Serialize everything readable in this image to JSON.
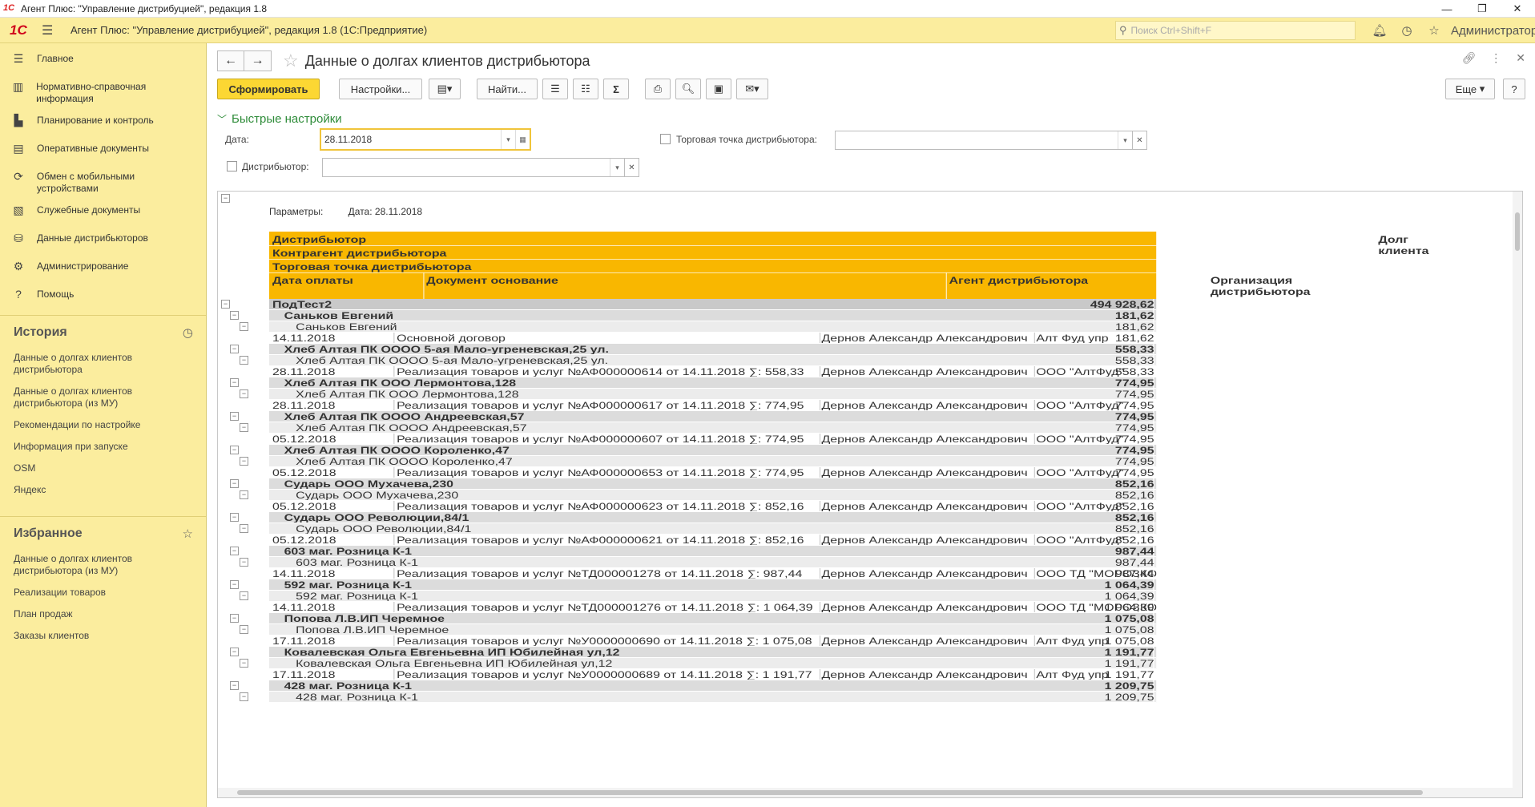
{
  "window": {
    "title": "Агент Плюс: \"Управление дистрибуцией\", редакция 1.8"
  },
  "appbar": {
    "title": "Агент Плюс: \"Управление дистрибуцией\", редакция 1.8  (1С:Предприятие)",
    "search_placeholder": "Поиск Ctrl+Shift+F",
    "user": "Администратор"
  },
  "sidebar": {
    "items": [
      {
        "label": "Главное",
        "icon": "menu-icon"
      },
      {
        "label": "Нормативно-справочная информация",
        "icon": "catalog-icon"
      },
      {
        "label": "Планирование и контроль",
        "icon": "chart-icon"
      },
      {
        "label": "Оперативные документы",
        "icon": "documents-icon"
      },
      {
        "label": "Обмен с мобильными устройствами",
        "icon": "sync-icon"
      },
      {
        "label": "Служебные документы",
        "icon": "service-docs-icon"
      },
      {
        "label": "Данные дистрибьюторов",
        "icon": "distributors-icon"
      },
      {
        "label": "Администрирование",
        "icon": "gear-icon"
      },
      {
        "label": "Помощь",
        "icon": "help-icon"
      }
    ],
    "history": {
      "title": "История",
      "items": [
        "Данные о долгах клиентов дистрибьютора",
        "Данные о долгах клиентов дистрибьютора (из МУ)",
        "Рекомендации по настройке",
        "Информация при запуске",
        "OSM",
        "Яндекс"
      ]
    },
    "favorites": {
      "title": "Избранное",
      "items": [
        "Данные о долгах клиентов дистрибьютора (из МУ)",
        "Реализации товаров",
        "План продаж",
        "Заказы клиентов"
      ]
    }
  },
  "page": {
    "title": "Данные о долгах клиентов дистрибьютора",
    "toolbar": {
      "generate": "Сформировать",
      "settings": "Настройки...",
      "find": "Найти...",
      "more": "Еще",
      "help": "?"
    },
    "quick_settings": {
      "title": "Быстрые настройки",
      "date_label": "Дата:",
      "date_value": "28.11.2018",
      "outlet_label": "Торговая точка дистрибьютора:",
      "distributor_label": "Дистрибьютор:"
    }
  },
  "report": {
    "params_label": "Параметры:",
    "params_value": "Дата: 28.11.2018",
    "headers": {
      "h1": "Дистрибьютор",
      "h2": "Контрагент дистрибьютора",
      "h3": "Торговая точка дистрибьютора",
      "date": "Дата оплаты",
      "doc": "Документ основание",
      "agent": "Агент дистрибьютора",
      "org": "Организация дистрибьютора",
      "debt": "Долг клиента"
    },
    "rows": [
      {
        "lvl": 0,
        "name": "ПодТест2",
        "sum": "494 928,62"
      },
      {
        "lvl": 1,
        "name": "Саньков Евгений",
        "sum": "181,62"
      },
      {
        "lvl": 2,
        "name": "Саньков Евгений",
        "sum": "181,62"
      },
      {
        "lvl": 3,
        "date": "14.11.2018",
        "doc": "Основной договор",
        "agent": "Дернов Александр Александрович",
        "org": "Алт Фуд упр",
        "sum": "181,62"
      },
      {
        "lvl": 1,
        "name": "Хлеб Алтая ПК ОООО 5-ая Мало-угреневская,25 ул.",
        "sum": "558,33"
      },
      {
        "lvl": 2,
        "name": "Хлеб Алтая ПК ОООО 5-ая Мало-угреневская,25 ул.",
        "sum": "558,33"
      },
      {
        "lvl": 3,
        "date": "28.11.2018",
        "doc": "Реализация товаров и услуг №АФ000000614 от 14.11.2018 ∑: 558,33",
        "agent": "Дернов Александр Александрович",
        "org": "ООО \"АлтФуд\"",
        "sum": "558,33"
      },
      {
        "lvl": 1,
        "name": "Хлеб Алтая ПК ООО Лермонтова,128",
        "sum": "774,95"
      },
      {
        "lvl": 2,
        "name": "Хлеб Алтая ПК ООО Лермонтова,128",
        "sum": "774,95"
      },
      {
        "lvl": 3,
        "date": "28.11.2018",
        "doc": "Реализация товаров и услуг №АФ000000617 от 14.11.2018 ∑: 774,95",
        "agent": "Дернов Александр Александрович",
        "org": "ООО \"АлтФуд\"",
        "sum": "774,95"
      },
      {
        "lvl": 1,
        "name": "Хлеб Алтая ПК ОООО Андреевская,57",
        "sum": "774,95"
      },
      {
        "lvl": 2,
        "name": "Хлеб Алтая ПК ОООО Андреевская,57",
        "sum": "774,95"
      },
      {
        "lvl": 3,
        "date": "05.12.2018",
        "doc": "Реализация товаров и услуг №АФ000000607 от 14.11.2018 ∑: 774,95",
        "agent": "Дернов Александр Александрович",
        "org": "ООО \"АлтФуд\"",
        "sum": "774,95"
      },
      {
        "lvl": 1,
        "name": "Хлеб Алтая ПК ОООО Короленко,47",
        "sum": "774,95"
      },
      {
        "lvl": 2,
        "name": "Хлеб Алтая ПК ОООО Короленко,47",
        "sum": "774,95"
      },
      {
        "lvl": 3,
        "date": "05.12.2018",
        "doc": "Реализация товаров и услуг №АФ000000653 от 14.11.2018 ∑: 774,95",
        "agent": "Дернов Александр Александрович",
        "org": "ООО \"АлтФуд\"",
        "sum": "774,95"
      },
      {
        "lvl": 1,
        "name": "Сударь ООО Мухачева,230",
        "sum": "852,16"
      },
      {
        "lvl": 2,
        "name": "Сударь ООО Мухачева,230",
        "sum": "852,16"
      },
      {
        "lvl": 3,
        "date": "05.12.2018",
        "doc": "Реализация товаров и услуг №АФ000000623 от 14.11.2018 ∑: 852,16",
        "agent": "Дернов Александр Александрович",
        "org": "ООО \"АлтФуд\"",
        "sum": "852,16"
      },
      {
        "lvl": 1,
        "name": "Сударь ООО Революции,84/1",
        "sum": "852,16"
      },
      {
        "lvl": 2,
        "name": "Сударь ООО Революции,84/1",
        "sum": "852,16"
      },
      {
        "lvl": 3,
        "date": "05.12.2018",
        "doc": "Реализация товаров и услуг №АФ000000621 от 14.11.2018 ∑: 852,16",
        "agent": "Дернов Александр Александрович",
        "org": "ООО \"АлтФуд\"",
        "sum": "852,16"
      },
      {
        "lvl": 1,
        "name": "603 маг. Розница К-1",
        "sum": "987,44"
      },
      {
        "lvl": 2,
        "name": "603 маг. Розница К-1",
        "sum": "987,44"
      },
      {
        "lvl": 3,
        "date": "14.11.2018",
        "doc": "Реализация товаров и услуг №ТД000001278 от 14.11.2018 ∑: 987,44",
        "agent": "Дернов Александр Александрович",
        "org": "ООО ТД \"МОРОЗКО\"",
        "sum": "987,44"
      },
      {
        "lvl": 1,
        "name": "592 маг. Розница К-1",
        "sum": "1 064,39"
      },
      {
        "lvl": 2,
        "name": "592 маг. Розница К-1",
        "sum": "1 064,39"
      },
      {
        "lvl": 3,
        "date": "14.11.2018",
        "doc": "Реализация товаров и услуг №ТД000001276 от 14.11.2018 ∑: 1 064,39",
        "agent": "Дернов Александр Александрович",
        "org": "ООО ТД \"МОРОЗКО\"",
        "sum": "1 064,39"
      },
      {
        "lvl": 1,
        "name": "Попова Л.В.ИП Черемное",
        "sum": "1 075,08"
      },
      {
        "lvl": 2,
        "name": "Попова Л.В.ИП Черемное",
        "sum": "1 075,08"
      },
      {
        "lvl": 3,
        "date": "17.11.2018",
        "doc": "Реализация товаров и услуг №У0000000690 от 14.11.2018 ∑: 1 075,08",
        "agent": "Дернов Александр Александрович",
        "org": "Алт Фуд упр",
        "sum": "1 075,08"
      },
      {
        "lvl": 1,
        "name": "Ковалевская Ольга Евгеньевна ИП Юбилейная ул,12",
        "sum": "1 191,77"
      },
      {
        "lvl": 2,
        "name": "Ковалевская Ольга Евгеньевна ИП Юбилейная ул,12",
        "sum": "1 191,77"
      },
      {
        "lvl": 3,
        "date": "17.11.2018",
        "doc": "Реализация товаров и услуг №У0000000689 от 14.11.2018 ∑: 1 191,77",
        "agent": "Дернов Александр Александрович",
        "org": "Алт Фуд упр",
        "sum": "1 191,77"
      },
      {
        "lvl": 1,
        "name": "428 маг. Розница К-1",
        "sum": "1 209,75"
      },
      {
        "lvl": 2,
        "name": "428 маг. Розница К-1",
        "sum": "1 209,75"
      }
    ]
  }
}
